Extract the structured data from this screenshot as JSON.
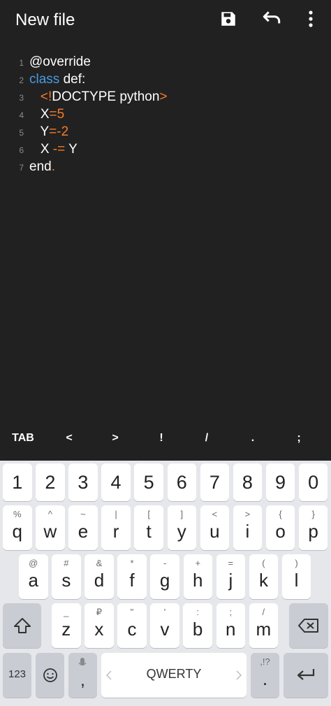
{
  "app": {
    "title": "New file",
    "icons": [
      "save-icon",
      "undo-icon",
      "more-vert-icon"
    ]
  },
  "editor": {
    "lines": [
      {
        "num": "1",
        "tokens": [
          {
            "text": "@override",
            "type": "plain"
          }
        ]
      },
      {
        "num": "2",
        "tokens": [
          {
            "text": "class",
            "type": "keyword"
          },
          {
            "text": " def:",
            "type": "plain"
          }
        ]
      },
      {
        "num": "3",
        "tokens": [
          {
            "text": "   ",
            "type": "plain"
          },
          {
            "text": "<!",
            "type": "orange"
          },
          {
            "text": "DOCTYPE python",
            "type": "plain"
          },
          {
            "text": ">",
            "type": "orange"
          }
        ]
      },
      {
        "num": "4",
        "tokens": [
          {
            "text": "   X",
            "type": "plain"
          },
          {
            "text": "=5",
            "type": "orange"
          }
        ]
      },
      {
        "num": "5",
        "tokens": [
          {
            "text": "   Y",
            "type": "plain"
          },
          {
            "text": "=-2",
            "type": "orange"
          }
        ]
      },
      {
        "num": "6",
        "tokens": [
          {
            "text": "   X ",
            "type": "plain"
          },
          {
            "text": "-=",
            "type": "orange"
          },
          {
            "text": " Y",
            "type": "plain"
          }
        ]
      },
      {
        "num": "7",
        "tokens": [
          {
            "text": "end",
            "type": "plain"
          },
          {
            "text": ".",
            "type": "orange"
          }
        ]
      }
    ]
  },
  "accessory_keys": [
    "TAB",
    "<",
    ">",
    "!",
    "/",
    ".",
    ";"
  ],
  "keyboard": {
    "number_row": [
      "1",
      "2",
      "3",
      "4",
      "5",
      "6",
      "7",
      "8",
      "9",
      "0"
    ],
    "row1": [
      {
        "main": "q",
        "sub": "%"
      },
      {
        "main": "w",
        "sub": "^"
      },
      {
        "main": "e",
        "sub": "~"
      },
      {
        "main": "r",
        "sub": "|"
      },
      {
        "main": "t",
        "sub": "["
      },
      {
        "main": "y",
        "sub": "]"
      },
      {
        "main": "u",
        "sub": "<"
      },
      {
        "main": "i",
        "sub": ">"
      },
      {
        "main": "o",
        "sub": "{"
      },
      {
        "main": "p",
        "sub": "}"
      }
    ],
    "row2": [
      {
        "main": "a",
        "sub": "@"
      },
      {
        "main": "s",
        "sub": "#"
      },
      {
        "main": "d",
        "sub": "&"
      },
      {
        "main": "f",
        "sub": "*"
      },
      {
        "main": "g",
        "sub": "-"
      },
      {
        "main": "h",
        "sub": "+"
      },
      {
        "main": "j",
        "sub": "="
      },
      {
        "main": "k",
        "sub": "("
      },
      {
        "main": "l",
        "sub": ")"
      }
    ],
    "row3": [
      {
        "main": "z",
        "sub": "_"
      },
      {
        "main": "x",
        "sub": "₽"
      },
      {
        "main": "c",
        "sub": "\""
      },
      {
        "main": "v",
        "sub": "'"
      },
      {
        "main": "b",
        "sub": ":"
      },
      {
        "main": "n",
        "sub": ";"
      },
      {
        "main": "m",
        "sub": "/"
      }
    ],
    "bottom": {
      "symbols_label": "123",
      "emoji_icon": "emoji-icon",
      "comma_label": ",",
      "comma_sub_icon": "mic-icon",
      "space_label": "QWERTY",
      "period_label": ".",
      "period_sub": ",!?",
      "enter_icon": "enter-icon"
    },
    "shift_icon": "shift-icon",
    "backspace_icon": "backspace-icon"
  },
  "colors": {
    "background": "#212121",
    "keyword": "#4a9be3",
    "accent_orange": "#f47b2c",
    "keyboard_bg": "#e6e7eb"
  }
}
